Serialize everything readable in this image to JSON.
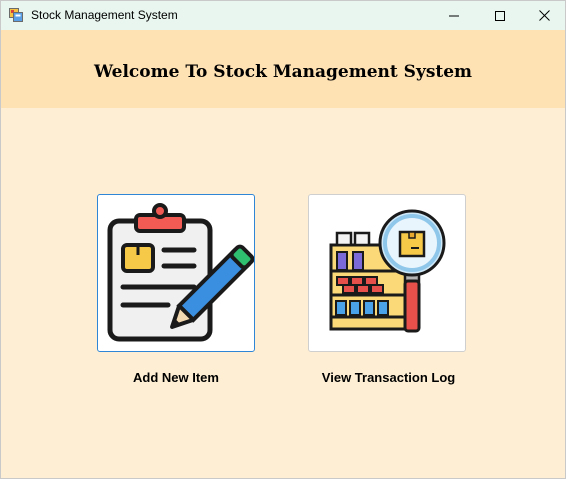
{
  "window": {
    "title": "Stock Management System",
    "icon": "app-window-icon",
    "controls": [
      "minimize-icon",
      "maximize-icon",
      "close-icon"
    ]
  },
  "header": {
    "welcome_text": "Welcome To Stock Management System"
  },
  "actions": [
    {
      "label": "Add New Item",
      "icon": "clipboard-pencil-icon"
    },
    {
      "label": "View Transaction Log",
      "icon": "warehouse-magnifier-icon"
    }
  ],
  "colors": {
    "background": "#feeed3",
    "header_band": "#fee2b4",
    "titlebar": "#e8f6ef",
    "focus_border": "#2f86d6"
  }
}
